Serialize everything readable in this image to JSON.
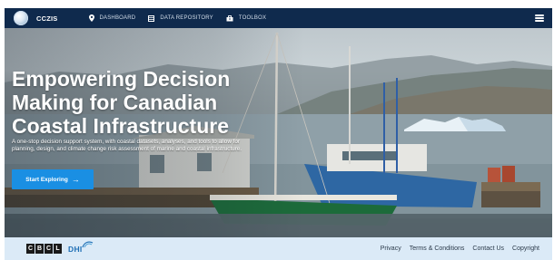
{
  "header": {
    "brand": "CCZIS",
    "nav": [
      {
        "label": "DASHBOARD",
        "icon": "location-pin-icon"
      },
      {
        "label": "DATA REPOSITORY",
        "icon": "database-icon"
      },
      {
        "label": "TOOLBOX",
        "icon": "toolbox-icon"
      }
    ],
    "menu_icon": "hamburger-menu-icon"
  },
  "hero": {
    "title": "Empowering Decision Making for Canadian Coastal Infrastructure",
    "subtitle": "A one-stop decision support system, with coastal datasets, analyses, and tools to allow for planning, design, and climate change risk assessment of marine and coastal infrastructure.",
    "cta_label": "Start Exploring",
    "cta_icon": "arrow-right-icon"
  },
  "footer": {
    "logos": [
      "CBCL",
      "DHI"
    ],
    "links": [
      "Privacy",
      "Terms & Conditions",
      "Contact Us",
      "Copyright"
    ]
  },
  "colors": {
    "nav_bg": "#0f2a4d",
    "cta_bg": "#1a8fe3",
    "footer_bg": "#dbeaf7"
  }
}
